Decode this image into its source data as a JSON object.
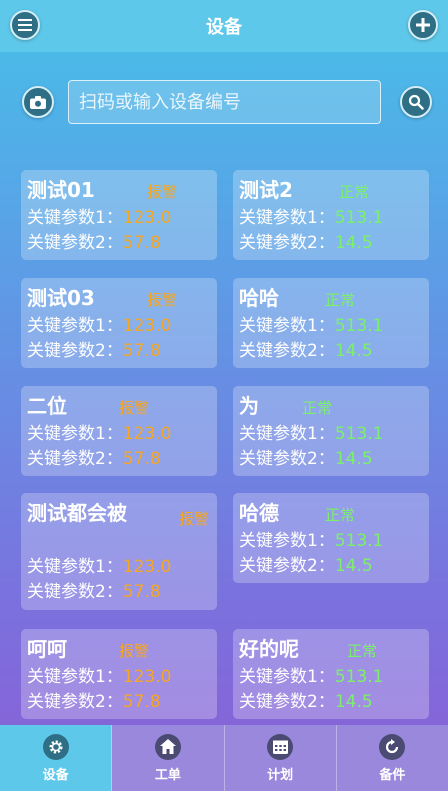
{
  "header": {
    "title": "设备"
  },
  "search": {
    "placeholder": "扫码或输入设备编号"
  },
  "devices": [
    {
      "name": "测试01",
      "status": "报警",
      "p1_label": "关键参数1：",
      "p1": "123.0",
      "p2_label": "关键参数2：",
      "p2": "57.8"
    },
    {
      "name": "测试2",
      "status": "正常",
      "p1_label": "关键参数1：",
      "p1": "513.1",
      "p2_label": "关键参数2：",
      "p2": "14.5"
    },
    {
      "name": "测试03",
      "status": "报警",
      "p1_label": "关键参数1：",
      "p1": "123.0",
      "p2_label": "关键参数2：",
      "p2": "57.8"
    },
    {
      "name": "哈哈",
      "status": "正常",
      "p1_label": "关键参数1：",
      "p1": "513.1",
      "p2_label": "关键参数2：",
      "p2": "14.5"
    },
    {
      "name": "二位",
      "status": "报警",
      "p1_label": "关键参数1：",
      "p1": "123.0",
      "p2_label": "关键参数2：",
      "p2": "57.8"
    },
    {
      "name": "为",
      "status": "正常",
      "p1_label": "关键参数1：",
      "p1": "513.1",
      "p2_label": "关键参数2：",
      "p2": "14.5"
    },
    {
      "name": "测试都会被",
      "status": "报警",
      "p1_label": "关键参数1：",
      "p1": "123.0",
      "p2_label": "关键参数2：",
      "p2": "57.8"
    },
    {
      "name": "哈德",
      "status": "正常",
      "p1_label": "关键参数1：",
      "p1": "513.1",
      "p2_label": "关键参数2：",
      "p2": "14.5"
    },
    {
      "name": "呵呵",
      "status": "报警",
      "p1_label": "关键参数1：",
      "p1": "123.0",
      "p2_label": "关键参数2：",
      "p2": "57.8"
    },
    {
      "name": "好的呢",
      "status": "正常",
      "p1_label": "关键参数1：",
      "p1": "513.1",
      "p2_label": "关键参数2：",
      "p2": "14.5"
    }
  ],
  "tabs": [
    {
      "label": "设备",
      "icon": "gear-icon"
    },
    {
      "label": "工单",
      "icon": "home-icon"
    },
    {
      "label": "计划",
      "icon": "calendar-icon"
    },
    {
      "label": "备件",
      "icon": "refresh-icon"
    }
  ],
  "colors": {
    "alarm": "#f5a623",
    "normal": "#7cf06a",
    "active_tab": "#5ec8ea"
  }
}
